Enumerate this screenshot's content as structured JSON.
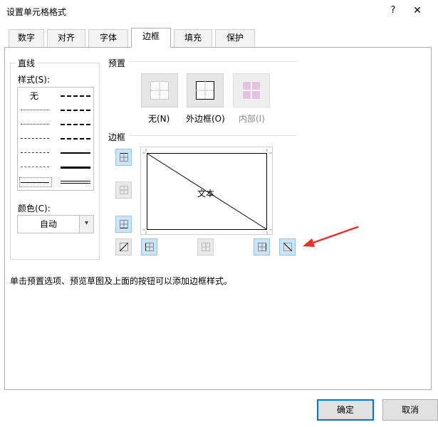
{
  "window": {
    "title": "设置单元格格式",
    "help_label": "?",
    "close_label": "✕"
  },
  "tabs": [
    {
      "label": "数字"
    },
    {
      "label": "对齐"
    },
    {
      "label": "字体"
    },
    {
      "label": "边框",
      "active": true
    },
    {
      "label": "填充"
    },
    {
      "label": "保护"
    }
  ],
  "line_section": {
    "title": "直线",
    "style_label": "样式(S):",
    "none_label": "无",
    "color_label": "颜色(C):",
    "color_value": "自动"
  },
  "presets": {
    "title": "预置",
    "items": [
      {
        "label": "无(N)",
        "enabled": true
      },
      {
        "label": "外边框(O)",
        "enabled": true
      },
      {
        "label": "内部(I)",
        "enabled": false
      }
    ]
  },
  "border": {
    "title": "边框",
    "preview_text": "文本"
  },
  "hint": "单击预置选项、预览草图及上面的按钮可以添加边框样式。",
  "buttons": {
    "ok": "确定",
    "cancel": "取消"
  },
  "colors": {
    "accent": "#0078d7",
    "annotation_arrow": "#e8312a",
    "toggle_on": "#cce4f7"
  }
}
